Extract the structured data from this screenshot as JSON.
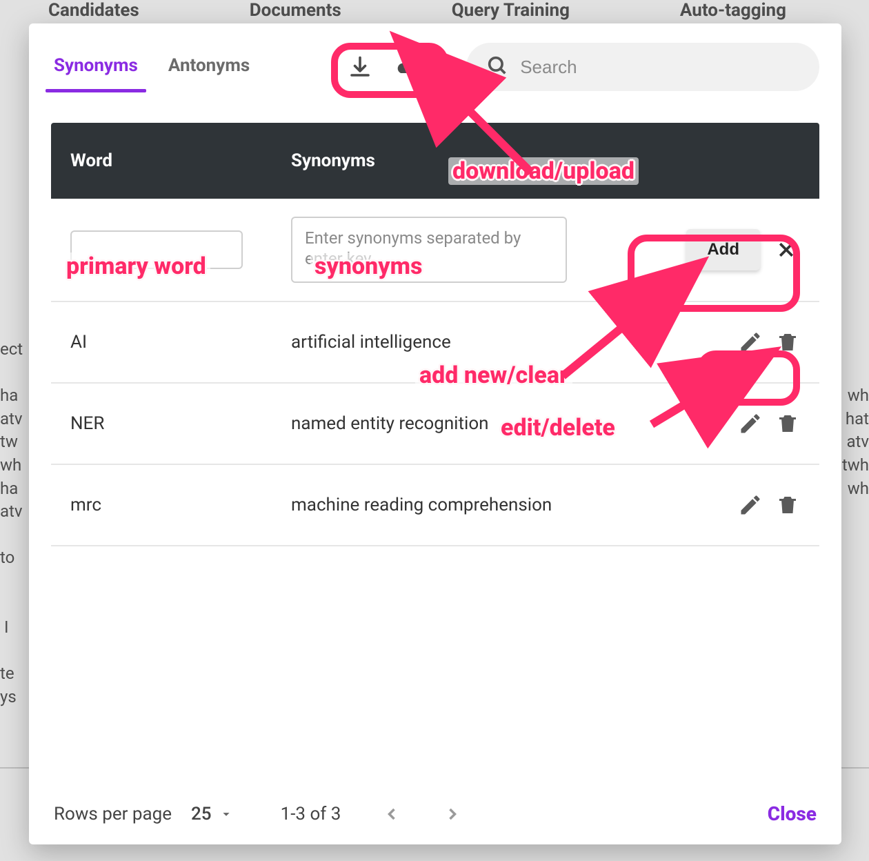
{
  "background": {
    "tabs": [
      "Candidates",
      "Documents",
      "Query Training",
      "Auto-tagging"
    ],
    "left_fragments": "ect\n\nha\natv\ntw\nwh\nha\natv\n\nto\n\n\n I\n\nte\nys",
    "right_fragments": "\n\nwh\nhat\natv\ntwh\nwh"
  },
  "tabs": {
    "synonyms": "Synonyms",
    "antonyms": "Antonyms",
    "active": "synonyms"
  },
  "search": {
    "placeholder": "Search"
  },
  "table": {
    "headers": {
      "word": "Word",
      "synonyms": "Synonyms"
    },
    "new_row": {
      "word_placeholder": "",
      "syn_placeholder": "Enter synonyms separated by enter key",
      "add_label": "Add"
    },
    "rows": [
      {
        "word": "AI",
        "synonyms": "artificial intelligence"
      },
      {
        "word": "NER",
        "synonyms": "named entity recognition"
      },
      {
        "word": "mrc",
        "synonyms": "machine reading comprehension"
      }
    ]
  },
  "footer": {
    "rows_per_page_label": "Rows per page",
    "rows_per_page_value": "25",
    "range_text": "1-3 of 3",
    "close_label": "Close"
  },
  "annotations": {
    "download_upload": "download/upload",
    "primary_word": "primary word",
    "synonyms": "synonyms",
    "add_new_clear": "add new/clear",
    "edit_delete": "edit/delete"
  },
  "colors": {
    "accent": "#8a2be2",
    "annotation": "#ff2a68",
    "header_bg": "#2f3438"
  }
}
